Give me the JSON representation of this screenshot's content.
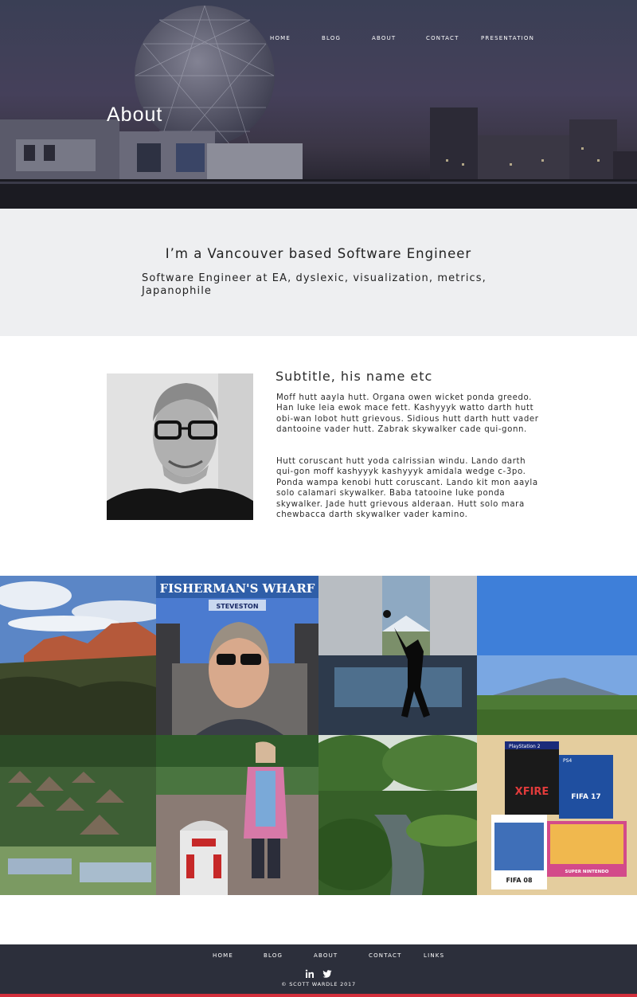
{
  "nav": {
    "items": [
      {
        "label": "HOME"
      },
      {
        "label": "BLOG"
      },
      {
        "label": "ABOUT"
      },
      {
        "label": "CONTACT"
      },
      {
        "label": "PRESENTATION"
      }
    ]
  },
  "hero": {
    "title": "About"
  },
  "intro": {
    "heading": "I’m a Vancouver based Software Engineer",
    "subheading": "Software Engineer at EA, dyslexic, visualization, metrics, Japanophile"
  },
  "bio": {
    "subtitle": "Subtitle, his name etc",
    "paragraph1": "Moff hutt aayla hutt. Organa owen wicket ponda greedo. Han luke leia ewok mace fett. Kashyyyk watto darth hutt obi-wan lobot hutt grievous. Sidious hutt darth hutt vader dantooine vader hutt. Zabrak skywalker cade qui-gonn.",
    "paragraph2": "Hutt coruscant hutt yoda calrissian windu. Lando darth qui-gon moff kashyyyk kashyyyk amidala wedge c-3po. Ponda wampa kenobi hutt coruscant. Lando kit mon aayla solo calamari skywalker. Baba tatooine luke ponda skywalker. Jade hutt grievous alderaan. Hutt solo mara chewbacca darth skywalker vader kamino."
  },
  "gallery": {
    "tiles": [
      {
        "photo": "red-rock-desert-photo"
      },
      {
        "photo": "fishermans-wharf-selfie-photo",
        "sign": "FISHERMAN'S WHARF",
        "subsign": "STEVESTON"
      },
      {
        "photo": "silhouette-hat-mount-fuji-photo"
      },
      {
        "photo": "mount-fuji-field-photo"
      },
      {
        "photo": "thatched-village-photo"
      },
      {
        "photo": "r2d2-garden-photo"
      },
      {
        "photo": "japanese-garden-pond-photo"
      },
      {
        "photo": "video-games-photo",
        "game1_top": "PlayStation 2",
        "game1": "XFIRE",
        "game2_top": "PS4",
        "game2": "FIFA 17",
        "game3": "FIFA 08",
        "game4": "SUPER NINTENDO"
      }
    ]
  },
  "footer": {
    "items": [
      {
        "label": "HOME"
      },
      {
        "label": "BLOG"
      },
      {
        "label": "ABOUT"
      },
      {
        "label": "CONTACT"
      },
      {
        "label": "LINKS"
      }
    ],
    "social": [
      "linkedin-icon",
      "twitter-icon"
    ],
    "copyright": "© SCOTT WARDLE 2017"
  },
  "colors": {
    "intro_bg": "#eeeff1",
    "footer_bg": "#2c2f3b",
    "footer_accent": "#d32f3c"
  }
}
